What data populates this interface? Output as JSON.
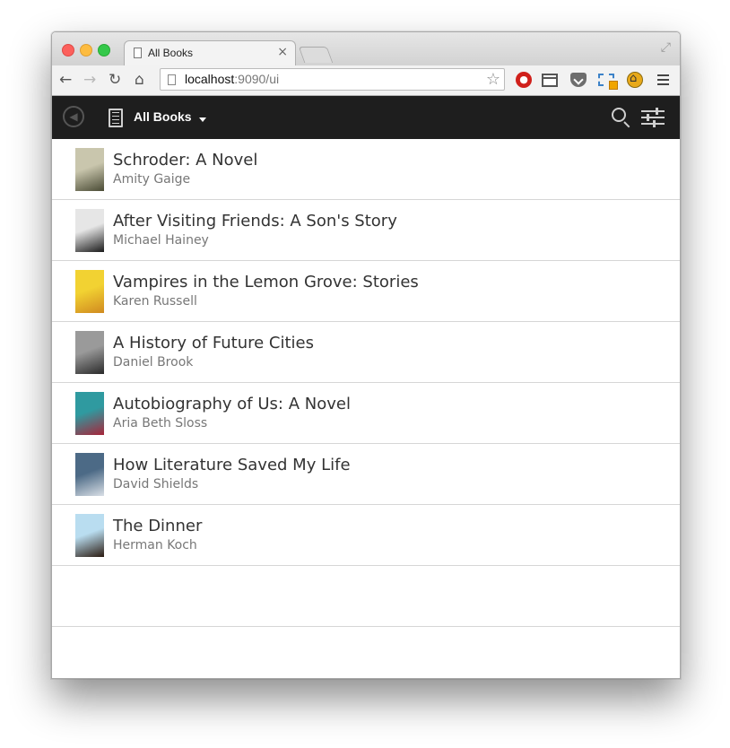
{
  "browser": {
    "tab_title": "All Books",
    "tab_close": "×",
    "url_host": "localhost",
    "url_rest": ":9090/ui"
  },
  "app": {
    "title": "All Books"
  },
  "books": [
    {
      "title": "Schroder: A Novel",
      "author": "Amity Gaige",
      "cover_colors": [
        "#c9c6ad",
        "#4a4b35"
      ]
    },
    {
      "title": "After Visiting Friends: A Son's Story",
      "author": "Michael Hainey",
      "cover_colors": [
        "#e6e6e6",
        "#1a1a1a"
      ]
    },
    {
      "title": "Vampires in the Lemon Grove: Stories",
      "author": "Karen Russell",
      "cover_colors": [
        "#f2d232",
        "#d08a20"
      ]
    },
    {
      "title": "A History of Future Cities",
      "author": "Daniel Brook",
      "cover_colors": [
        "#9a9a9a",
        "#2a2a2a"
      ]
    },
    {
      "title": "Autobiography of Us: A Novel",
      "author": "Aria Beth Sloss",
      "cover_colors": [
        "#2f9aa0",
        "#a8253a"
      ]
    },
    {
      "title": "How Literature Saved My Life",
      "author": "David Shields",
      "cover_colors": [
        "#4c6a86",
        "#d9dfe6"
      ]
    },
    {
      "title": "The Dinner",
      "author": "Herman Koch",
      "cover_colors": [
        "#b9ddf0",
        "#2a1a10"
      ]
    }
  ]
}
